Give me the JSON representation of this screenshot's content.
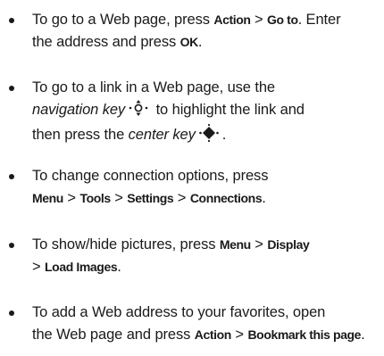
{
  "items": [
    {
      "line1_pre": "To go to a Web page, press ",
      "key_action": "Action",
      "sep1": " > ",
      "key_goto": "Go to",
      "line1_post": ". Enter",
      "line2_pre": "the address and press ",
      "key_ok": "OK",
      "line2_post": "."
    },
    {
      "line1": "To go to a link in a Web page, use the",
      "nav_key_label": "navigation key",
      "nav_key_icon": "navigation-key-icon",
      "line2_post": " to highlight the link and",
      "line3_pre": "then press the ",
      "center_key_label": "center key",
      "center_key_icon": "center-key-icon",
      "line3_post": "."
    },
    {
      "line1": "To change connection options, press",
      "key_menu": "Menu",
      "sep1": " > ",
      "key_tools": "Tools",
      "sep2": " > ",
      "key_settings": "Settings",
      "sep3": " > ",
      "key_connections": "Connections",
      "line2_post": "."
    },
    {
      "line1_pre": "To show/hide pictures, press ",
      "key_menu": "Menu",
      "sep1": " > ",
      "key_display": "Display",
      "line2_pre": "> ",
      "key_load_images": "Load Images",
      "line2_post": "."
    },
    {
      "line1": "To add a Web address to your favorites, open",
      "line2_pre": "the Web page and press ",
      "key_action": "Action",
      "sep1": " > ",
      "key_bookmark": "Bookmark this page",
      "line2_post": "."
    }
  ]
}
